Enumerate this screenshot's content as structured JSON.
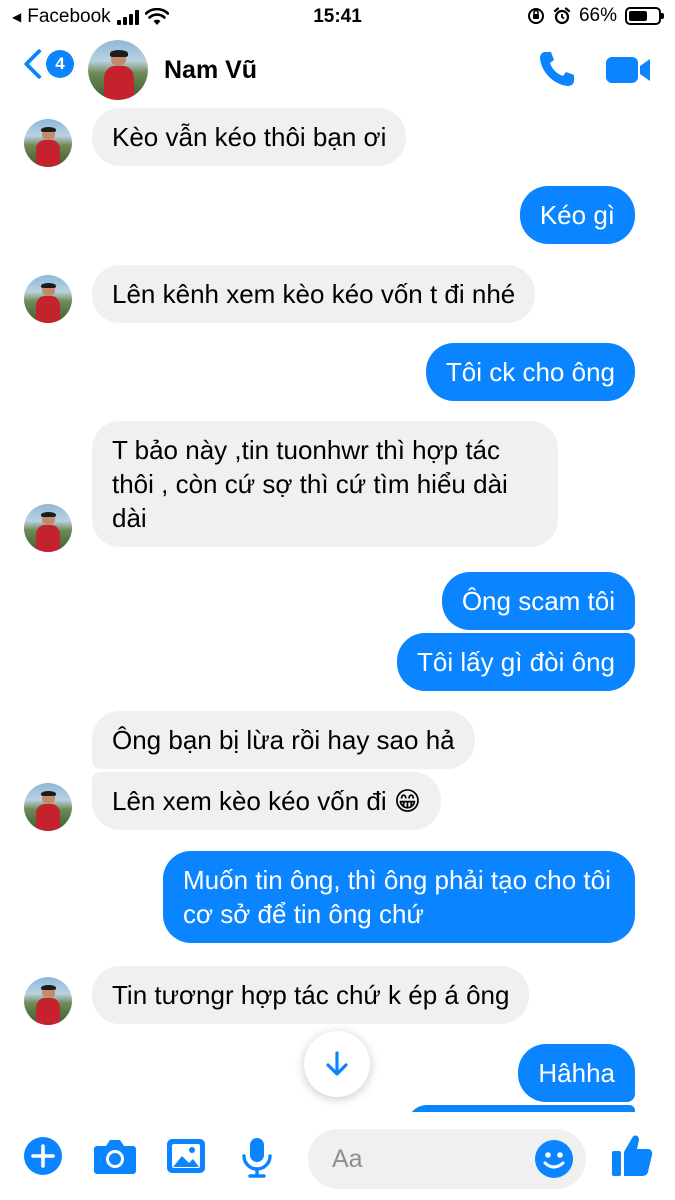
{
  "status_bar": {
    "back_app": "Facebook",
    "time": "15:41",
    "battery": "66%",
    "battery_level": 0.66
  },
  "header": {
    "back_badge": "4",
    "contact_name": "Nam Vũ",
    "call_icon": "phone-icon",
    "video_icon": "video-camera-icon"
  },
  "messages": [
    {
      "side": "in",
      "text": "Kèo vẫn kéo thôi bạn ơi"
    },
    {
      "side": "out",
      "text": "Kéo gì"
    },
    {
      "side": "in",
      "text": "Lên kênh xem kèo kéo vốn t đi nhé"
    },
    {
      "side": "out",
      "text": "Tôi ck cho ông"
    },
    {
      "side": "in",
      "text": "T bảo này ,tin tuonhwr thì hợp tác thôi , còn cứ sợ thì cứ tìm hiểu dài dài"
    },
    {
      "side": "out",
      "text": "Ông scam tôi"
    },
    {
      "side": "out",
      "text": "Tôi lấy gì đòi ông"
    },
    {
      "side": "in",
      "text": "Ông bạn bị lừa rồi hay sao hả"
    },
    {
      "side": "in",
      "text": "Lên xem kèo kéo vốn đi 😁"
    },
    {
      "side": "out",
      "text": "Muốn tin ông, thì ông phải tạo cho tôi cơ sở để tin ông chứ"
    },
    {
      "side": "in",
      "text": "Tin tươngr hợp tác chứ k ép á ông"
    },
    {
      "side": "out",
      "text": "Hâhha"
    }
  ],
  "composer": {
    "placeholder": "Aa"
  },
  "colors": {
    "accent": "#0a84ff",
    "incoming_bubble": "#f0f0f0",
    "outgoing_bubble": "#0a84ff"
  }
}
